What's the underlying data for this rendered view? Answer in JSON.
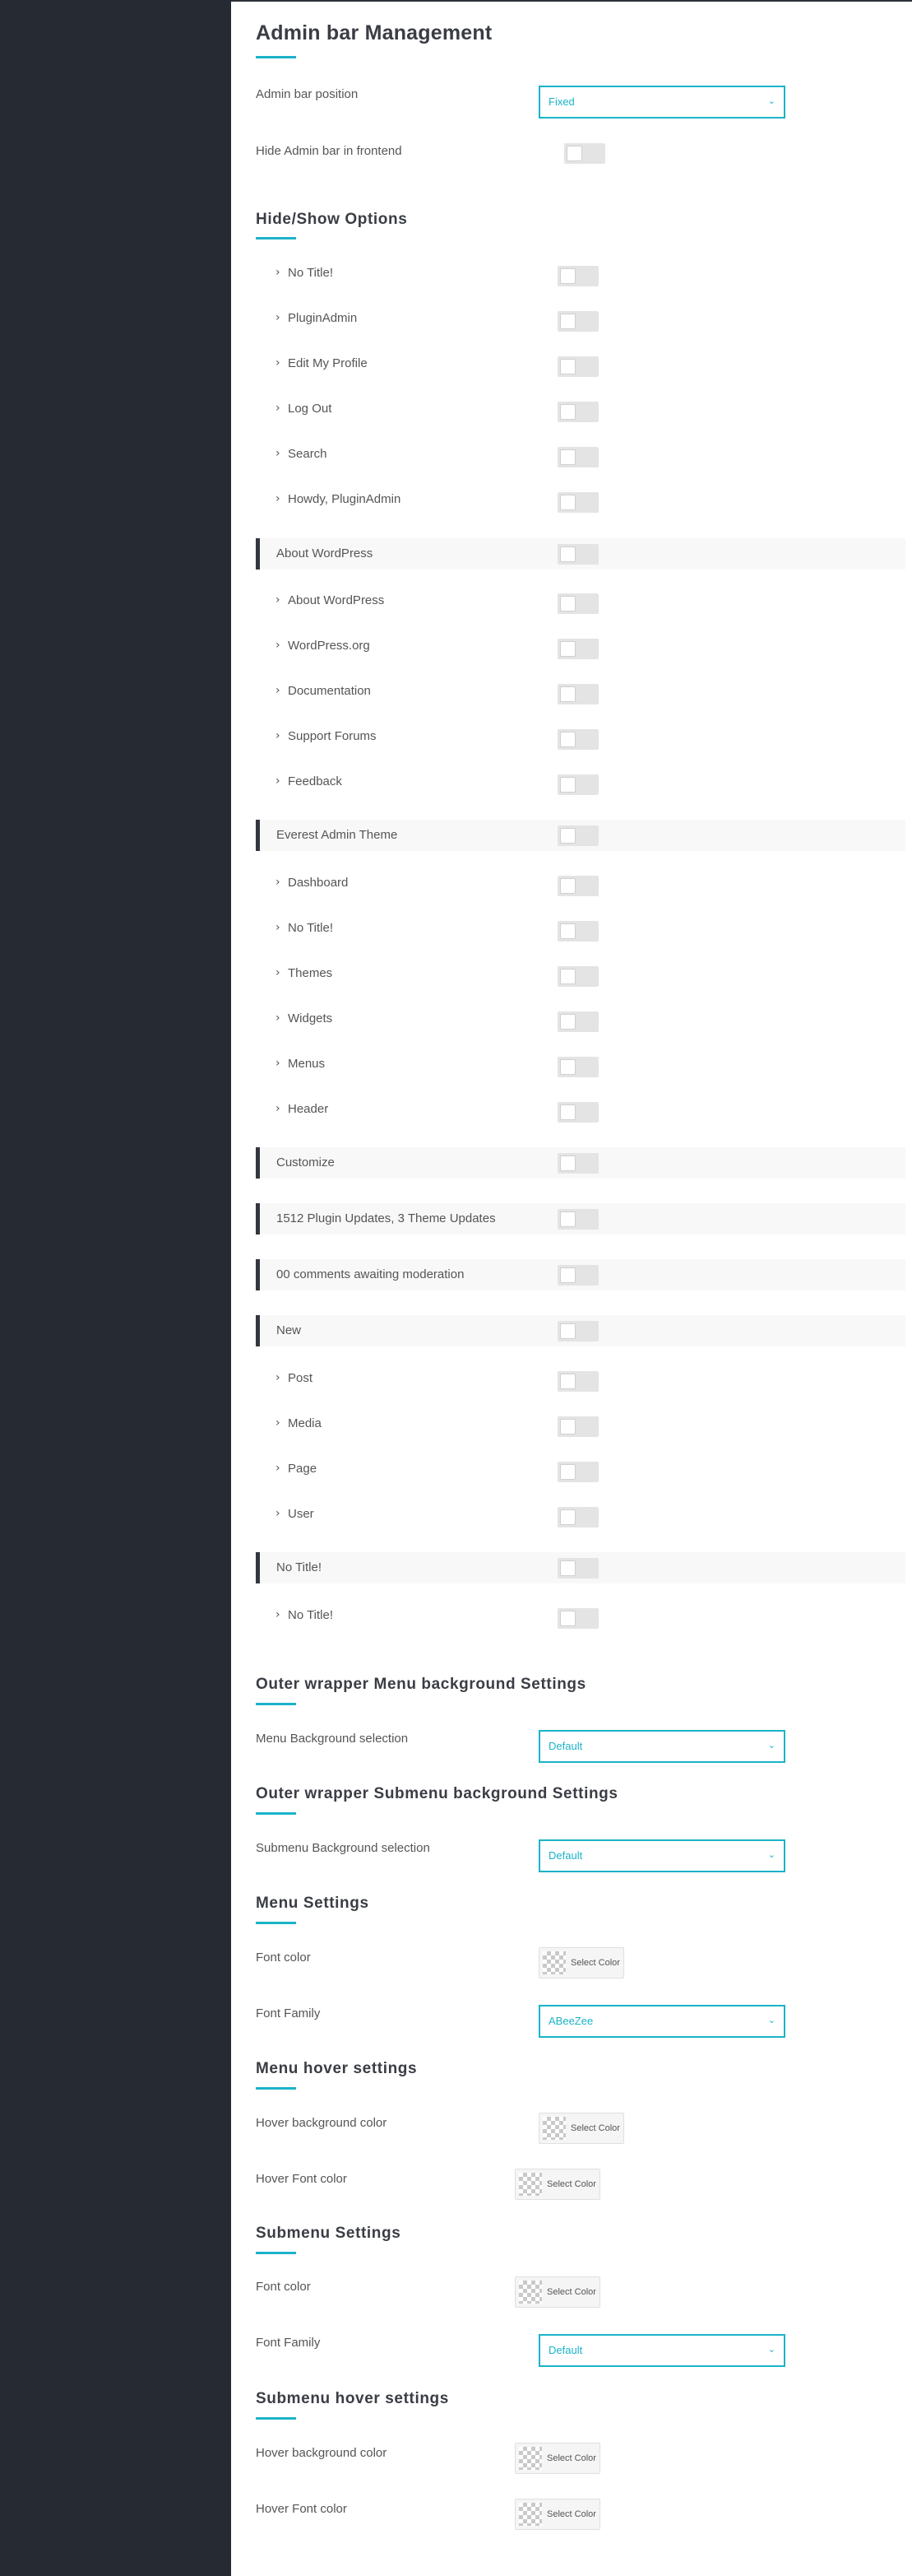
{
  "page": {
    "title": "Admin bar Management",
    "accent_color": "#1bb3c8",
    "sidebar_color": "#262a33"
  },
  "general": {
    "position_label": "Admin bar position",
    "position_value": "Fixed",
    "hide_frontend_label": "Hide Admin bar in frontend"
  },
  "hide_show": {
    "title": "Hide/Show Options",
    "top_items": [
      "No Title!",
      "PluginAdmin",
      "Edit My Profile",
      "Log Out",
      "Search",
      "Howdy, PluginAdmin"
    ],
    "group_about": "About WordPress",
    "about_items": [
      "About WordPress",
      "WordPress.org",
      "Documentation",
      "Support Forums",
      "Feedback"
    ],
    "group_everest": "Everest Admin Theme",
    "everest_items": [
      "Dashboard",
      "No Title!",
      "Themes",
      "Widgets",
      "Menus",
      "Header"
    ],
    "group_customize": "Customize",
    "group_updates": "1512 Plugin Updates, 3 Theme Updates",
    "group_comments": "00 comments awaiting moderation",
    "group_new": "New",
    "new_items": [
      "Post",
      "Media",
      "Page",
      "User"
    ],
    "group_notitle": "No Title!",
    "notitle_items": [
      "No Title!"
    ]
  },
  "outer_menu": {
    "title": "Outer wrapper Menu background Settings",
    "label": "Menu Background selection",
    "value": "Default"
  },
  "outer_submenu": {
    "title": "Outer wrapper Submenu background Settings",
    "label": "Submenu Background selection",
    "value": "Default"
  },
  "menu_settings": {
    "title": "Menu Settings",
    "font_color_label": "Font color",
    "font_family_label": "Font Family",
    "font_family_value": "ABeeZee"
  },
  "menu_hover": {
    "title": "Menu hover settings",
    "bg_label": "Hover background color",
    "font_label": "Hover Font color"
  },
  "submenu_settings": {
    "title": "Submenu Settings",
    "font_color_label": "Font color",
    "font_family_label": "Font Family",
    "font_family_value": "Default"
  },
  "submenu_hover": {
    "title": "Submenu hover settings",
    "bg_label": "Hover background color",
    "font_label": "Hover Font color"
  },
  "common": {
    "select_color": "Select Color",
    "chevron": "›",
    "caret": "⌄"
  }
}
